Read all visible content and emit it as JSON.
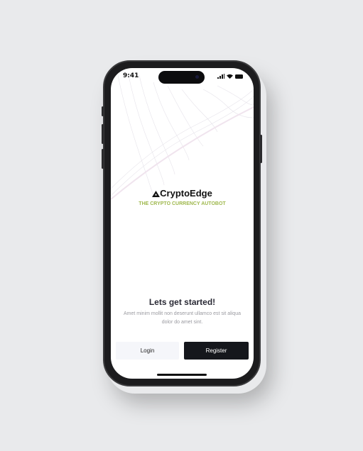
{
  "status_bar": {
    "time": "9:41",
    "icons": [
      "signal-icon",
      "wifi-icon",
      "battery-icon"
    ]
  },
  "brand": {
    "name": "CryptoEdge",
    "tagline": "THE CRYPTO CURRENCY AUTOBOT",
    "logo_icon": "mountain-icon",
    "accent": "#9fb84d"
  },
  "onboarding": {
    "heading": "Lets get started!",
    "subtext": "Amet minim mollit non deserunt ullamco est sit aliqua dolor do amet sint."
  },
  "buttons": {
    "login": "Login",
    "register": "Register"
  }
}
